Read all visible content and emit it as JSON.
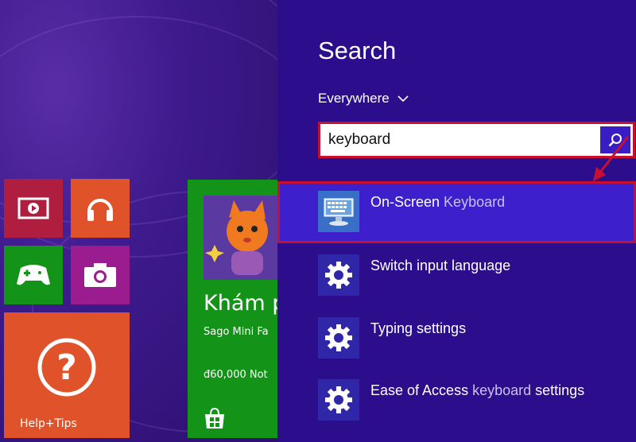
{
  "start": {
    "help_label": "Help+Tips",
    "store_title": "Khám p",
    "store_subtitle": "Sago Mini Fa",
    "store_price": "đ60,000 Not"
  },
  "search": {
    "title": "Search",
    "scope": "Everywhere",
    "query": "keyboard",
    "results": [
      {
        "prefix": "On-Screen ",
        "highlight": "Keyboard",
        "suffix": "",
        "icon": "keyboard-app-icon"
      },
      {
        "prefix": "Switch input language",
        "highlight": "",
        "suffix": "",
        "icon": "gear-icon"
      },
      {
        "prefix": "Typing settings",
        "highlight": "",
        "suffix": "",
        "icon": "gear-icon"
      },
      {
        "prefix": "Ease of Access ",
        "highlight": "keyboard",
        "suffix": " settings",
        "icon": "gear-icon"
      }
    ]
  },
  "colors": {
    "charm_bg": "#2c0e8c",
    "selected_bg": "#3d1fcb",
    "annotation_red": "#c8102e",
    "search_button": "#3a1cc4"
  }
}
